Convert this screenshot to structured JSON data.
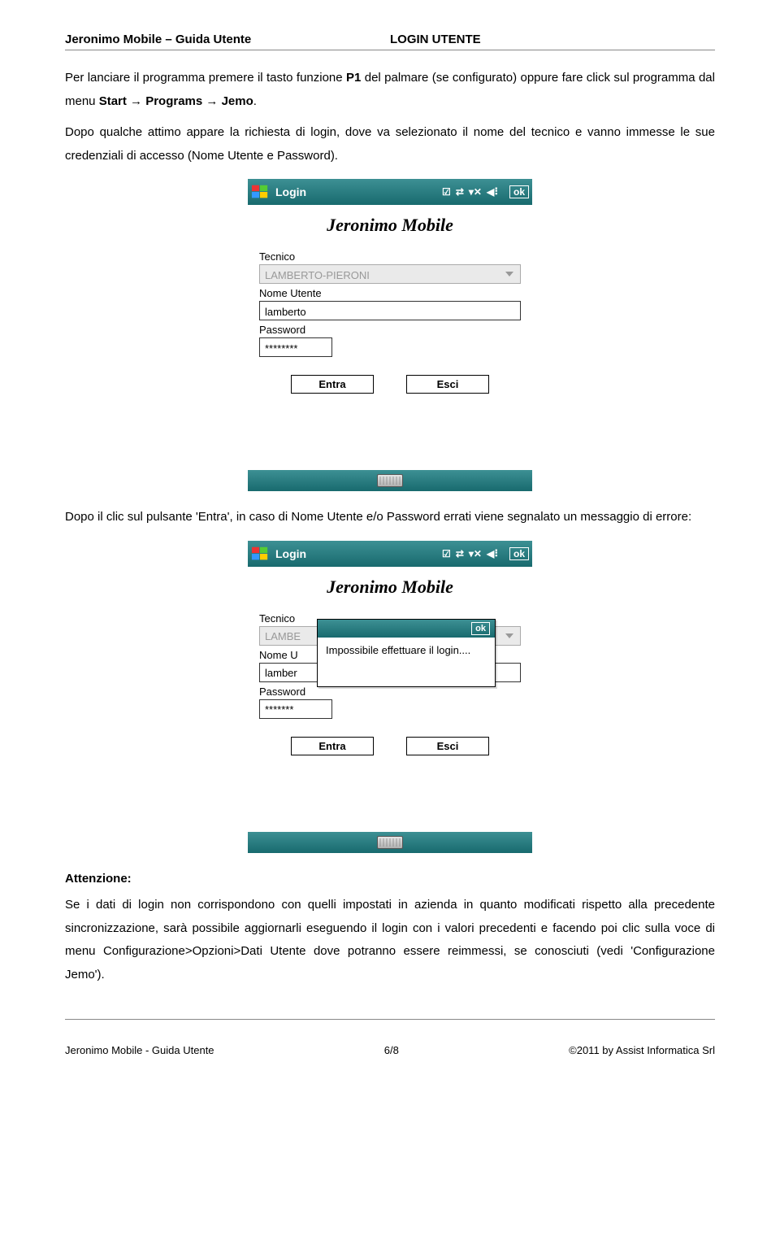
{
  "header": {
    "left": "Jeronimo Mobile – Guida Utente",
    "right": "LOGIN UTENTE"
  },
  "para1_pre": "Per lanciare il programma premere il tasto funzione ",
  "para1_p1": "P1",
  "para1_mid": " del palmare (se configurato) oppure fare click sul programma dal menu ",
  "para1_path": "Start → Programs → Jemo",
  "para1_end": ".",
  "para2": "Dopo qualche attimo appare la richiesta di login, dove va selezionato il nome del tecnico e vanno immesse le sue credenziali di accesso (Nome Utente e Password).",
  "mob1": {
    "title": "Login",
    "app": "Jeronimo Mobile",
    "lbl_tecnico": "Tecnico",
    "val_tecnico": "LAMBERTO-PIERONI",
    "lbl_nome": "Nome Utente",
    "val_nome": "lamberto",
    "lbl_pw": "Password",
    "val_pw": "********",
    "btn_entra": "Entra",
    "btn_esci": "Esci",
    "ok": "ok"
  },
  "para3": "Dopo il clic sul pulsante 'Entra', in caso di Nome Utente e/o Password errati viene segnalato un messaggio di errore:",
  "mob2": {
    "title": "Login",
    "app": "Jeronimo Mobile",
    "lbl_tecnico": "Tecnico",
    "val_tecnico": "LAMBE",
    "lbl_nome": "Nome U",
    "val_nome": "lamber",
    "lbl_pw": "Password",
    "val_pw": "*******",
    "btn_entra": "Entra",
    "btn_esci": "Esci",
    "ok": "ok",
    "popup_ok": "ok",
    "popup_msg": "Impossibile effettuare il login...."
  },
  "att_title": "Attenzione:",
  "att_body": "Se i dati di login non corrispondono con quelli impostati in azienda in quanto modificati rispetto alla precedente sincronizzazione, sarà possibile aggiornarli eseguendo il login con i valori precedenti e facendo poi clic sulla voce di menu Configurazione>Opzioni>Dati Utente dove potranno essere reimmessi, se conosciuti (vedi 'Configurazione Jemo').",
  "footer": {
    "left": "Jeronimo Mobile - Guida Utente",
    "center": "6/8",
    "right": "©2011 by Assist Informatica Srl"
  }
}
